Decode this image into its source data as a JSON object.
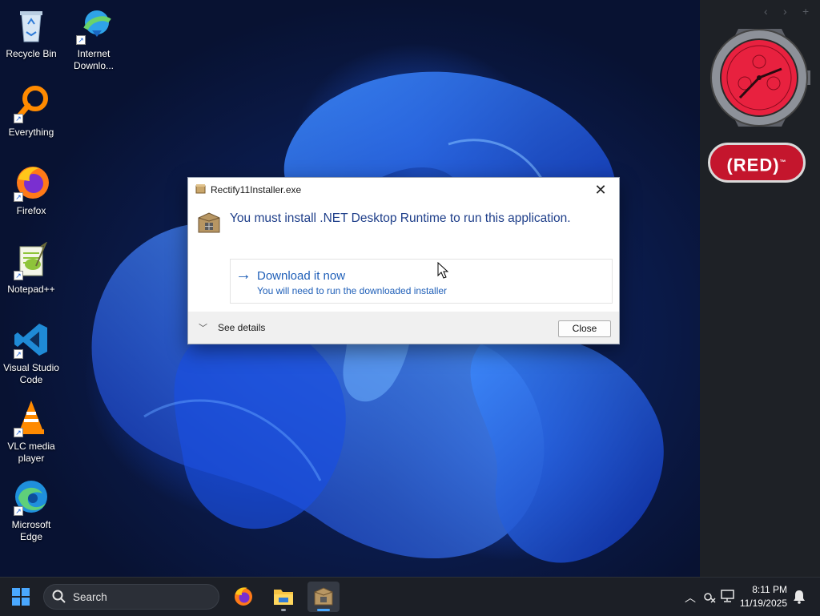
{
  "desktop": {
    "icons": [
      {
        "label": "Recycle Bin",
        "icon": "recycle-bin-icon",
        "shortcut": false
      },
      {
        "label": "Internet Downlo...",
        "icon": "internet-download-manager-icon",
        "shortcut": true
      },
      {
        "label": "Everything",
        "icon": "everything-search-icon",
        "shortcut": true
      },
      {
        "label": "Firefox",
        "icon": "firefox-icon",
        "shortcut": true
      },
      {
        "label": "Notepad++",
        "icon": "notepad-plus-plus-icon",
        "shortcut": true
      },
      {
        "label": "Visual Studio Code",
        "icon": "vscode-icon",
        "shortcut": true
      },
      {
        "label": "VLC media player",
        "icon": "vlc-icon",
        "shortcut": true
      },
      {
        "label": "Microsoft Edge",
        "icon": "edge-icon",
        "shortcut": true
      }
    ]
  },
  "side_panel": {
    "nav": [
      "‹",
      "›",
      "+"
    ],
    "badge_text": "(RED)",
    "badge_mark": "™",
    "badge_color": "#c4162d",
    "watch_face_color": "#e8213f"
  },
  "dialog": {
    "title": "Rectify11Installer.exe",
    "message": "You must install .NET Desktop Runtime to run this application.",
    "option_title": "Download it now",
    "option_subtitle": "You will need to run the downloaded installer",
    "details_label": "See details",
    "close_button": "Close",
    "close_glyph": "✕",
    "accent_color": "#1f5fb8"
  },
  "taskbar": {
    "search_placeholder": "Search",
    "apps": [
      "firefox-icon",
      "file-explorer-icon",
      "installer-package-icon"
    ],
    "active_app": "installer-package-icon",
    "time": "8:11 PM",
    "date": "11/19/2025"
  }
}
